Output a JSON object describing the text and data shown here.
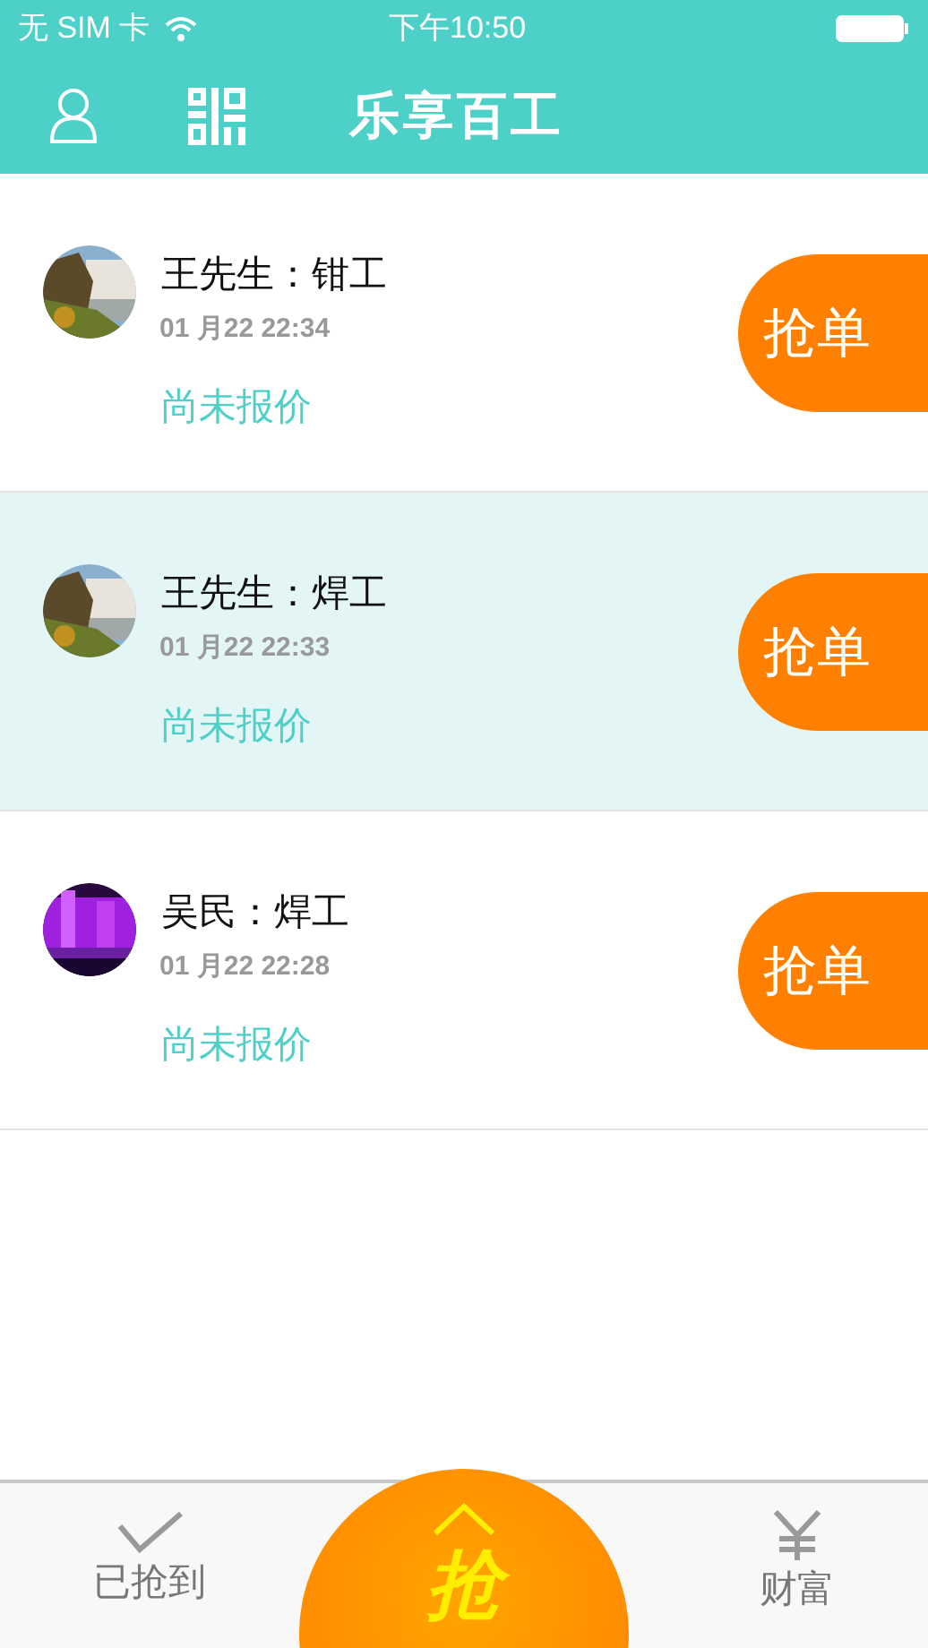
{
  "status_bar": {
    "carrier": "无 SIM 卡",
    "time": "下午10:50"
  },
  "header": {
    "title": "乐享百工"
  },
  "orders": [
    {
      "title": "王先生：钳工",
      "time": "01 月22 22:34",
      "status": "尚未报价",
      "action": "抢单",
      "selected": false
    },
    {
      "title": "王先生：焊工",
      "time": "01 月22 22:33",
      "status": "尚未报价",
      "action": "抢单",
      "selected": true
    },
    {
      "title": "吴民：焊工",
      "time": "01 月22 22:28",
      "status": "尚未报价",
      "action": "抢单",
      "selected": false
    }
  ],
  "tab_bar": {
    "left": {
      "label": "已抢到"
    },
    "center": {
      "label": "抢"
    },
    "right": {
      "label": "财富"
    }
  }
}
